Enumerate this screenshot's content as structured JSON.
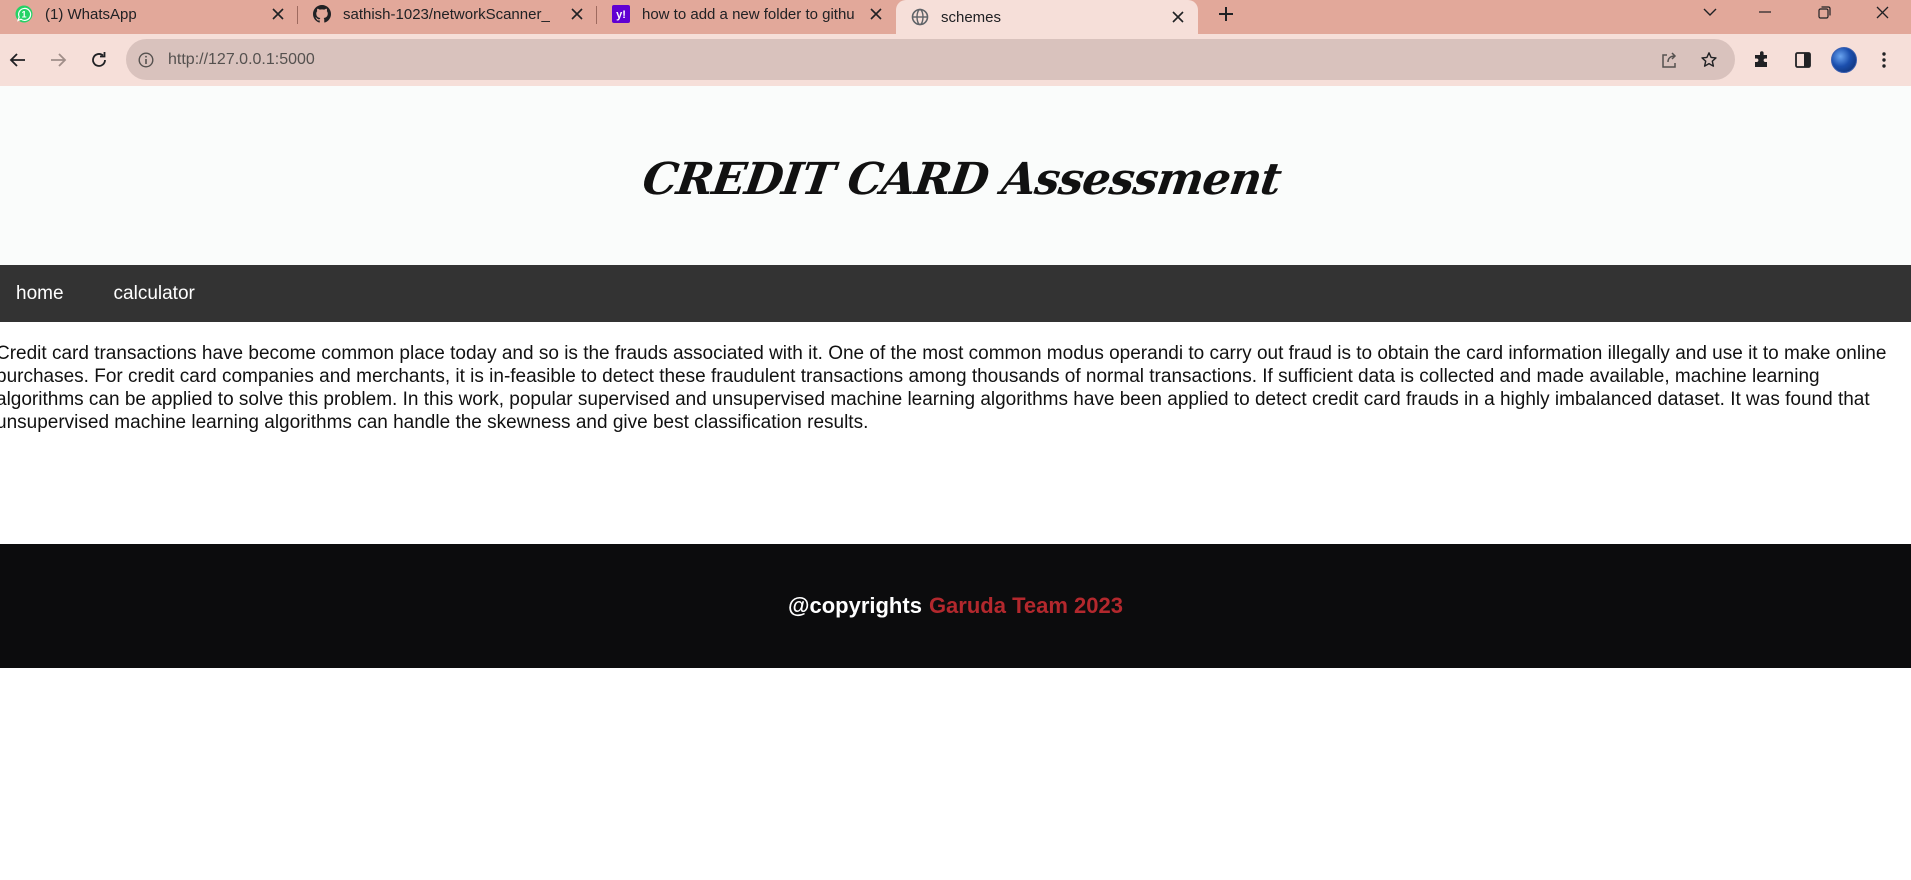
{
  "browser": {
    "tabs": [
      {
        "title": "(1) WhatsApp",
        "icon": "whatsapp-icon"
      },
      {
        "title": "sathish-1023/networkScanner_",
        "icon": "github-icon"
      },
      {
        "title": "how to add a new folder to githu",
        "icon": "yahoo-icon"
      },
      {
        "title": "schemes",
        "icon": "globe-icon",
        "active": true
      }
    ],
    "url": "http://127.0.0.1:5000"
  },
  "page": {
    "title": "CREDIT CARD Assessment",
    "nav": [
      {
        "label": "home"
      },
      {
        "label": "calculator"
      }
    ],
    "paragraph": "Credit card transactions have become common place today and so is the frauds associated with it. One of the most common modus operandi to carry out fraud is to obtain the card information illegally and use it to make online purchases. For credit card companies and merchants, it is in-feasible to detect these fraudulent transactions among thousands of normal transactions. If sufficient data is collected and made available, machine learning algorithms can be applied to solve this problem. In this work, popular supervised and unsupervised machine learning algorithms have been applied to detect credit card frauds in a highly imbalanced dataset. It was found that unsupervised machine learning algorithms can handle the skewness and give best classification results.",
    "footer": {
      "prefix": "@copyrights",
      "team": "Garuda Team 2023"
    }
  },
  "colors": {
    "tabstrip": "#e2a89a",
    "toolbar": "#f6dfd9",
    "navbar": "#333333",
    "footer": "#0c0c0d",
    "footer_accent": "#b3282d"
  }
}
